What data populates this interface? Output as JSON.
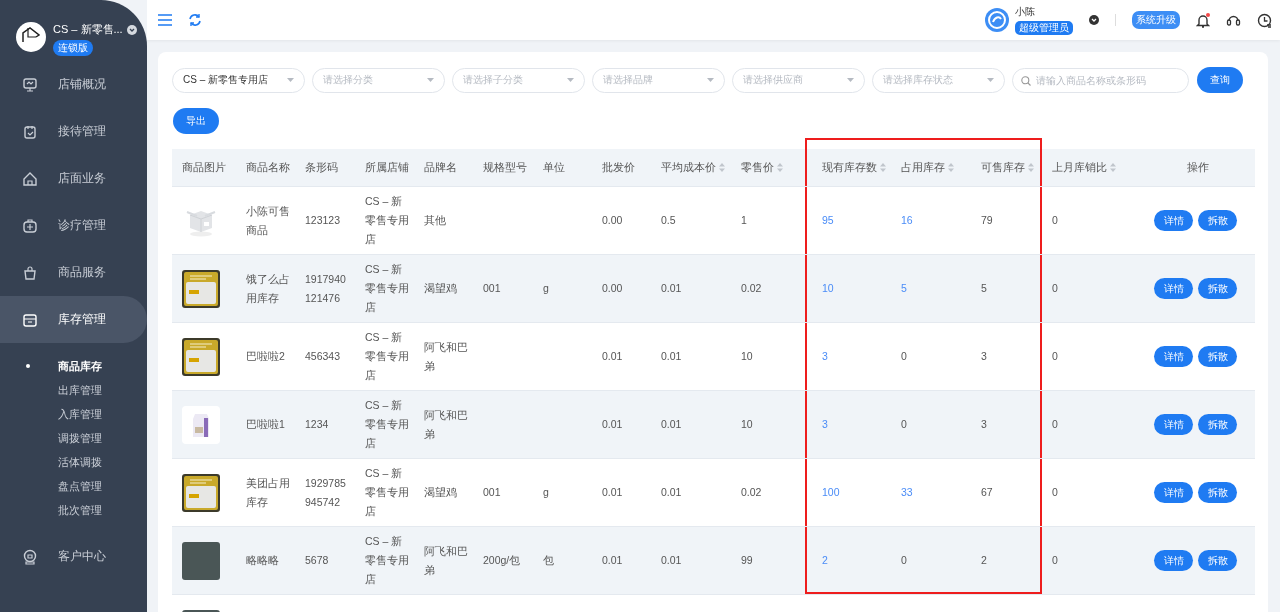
{
  "sidebar": {
    "store_name": "CS – 新零售...",
    "edition_badge": "连锁版",
    "menu": [
      {
        "label": "店铺概况",
        "selected": false,
        "expanded": false
      },
      {
        "label": "接待管理",
        "selected": false,
        "expanded": false
      },
      {
        "label": "店面业务",
        "selected": false,
        "expanded": false
      },
      {
        "label": "诊疗管理",
        "selected": false,
        "expanded": false
      },
      {
        "label": "商品服务",
        "selected": false,
        "expanded": false
      },
      {
        "label": "库存管理",
        "selected": true,
        "expanded": true,
        "children": [
          {
            "label": "商品库存",
            "selected": true
          },
          {
            "label": "出库管理",
            "selected": false
          },
          {
            "label": "入库管理",
            "selected": false
          },
          {
            "label": "调拨管理",
            "selected": false
          },
          {
            "label": "活体调拨",
            "selected": false
          },
          {
            "label": "盘点管理",
            "selected": false
          },
          {
            "label": "批次管理",
            "selected": false
          }
        ]
      },
      {
        "label": "客户中心",
        "selected": false,
        "expanded": false
      }
    ]
  },
  "topbar": {
    "user_name": "小陈",
    "role_badge": "超级管理员",
    "upgrade_button": "系统升级",
    "unread_notifications": true
  },
  "filters": {
    "dropdowns": [
      {
        "value": "CS – 新零售专用店"
      },
      {
        "placeholder": "请选择分类"
      },
      {
        "placeholder": "请选择子分类"
      },
      {
        "placeholder": "请选择品牌"
      },
      {
        "placeholder": "请选择供应商"
      },
      {
        "placeholder": "请选择库存状态"
      }
    ],
    "search": {
      "placeholder": "请输入商品名称或条形码"
    },
    "query_button": "查询",
    "export_button": "导出"
  },
  "table": {
    "columns": [
      {
        "label": "商品图片",
        "sortable": false,
        "highlighted": false
      },
      {
        "label": "商品名称",
        "sortable": false,
        "highlighted": false
      },
      {
        "label": "条形码",
        "sortable": false,
        "highlighted": false
      },
      {
        "label": "所属店铺",
        "sortable": false,
        "highlighted": false
      },
      {
        "label": "品牌名",
        "sortable": false,
        "highlighted": false
      },
      {
        "label": "规格型号",
        "sortable": false,
        "highlighted": false
      },
      {
        "label": "单位",
        "sortable": false,
        "highlighted": false
      },
      {
        "label": "批发价",
        "sortable": false,
        "highlighted": false
      },
      {
        "label": "平均成本价",
        "sortable": true,
        "highlighted": false
      },
      {
        "label": "零售价",
        "sortable": true,
        "highlighted": false
      },
      {
        "label": "现有库存数",
        "sortable": true,
        "highlighted": true
      },
      {
        "label": "占用库存",
        "sortable": true,
        "highlighted": true
      },
      {
        "label": "可售库存",
        "sortable": true,
        "highlighted": true
      },
      {
        "label": "上月库销比",
        "sortable": true,
        "highlighted": false
      },
      {
        "label": "操作",
        "sortable": false,
        "highlighted": false
      }
    ],
    "rows": [
      {
        "image": {
          "kind": "box"
        },
        "cells": [
          {
            "text": "小陈可售商品"
          },
          {
            "text": "123123"
          },
          {
            "text": "CS – 新零售专用店"
          },
          {
            "text": "其他"
          },
          {},
          {},
          {
            "text": "0.00"
          },
          {
            "text": "0.5"
          },
          {
            "text": "1"
          },
          {
            "text": "95",
            "link": true
          },
          {
            "text": "16",
            "link": true
          },
          {
            "text": "79"
          },
          {
            "text": "0"
          }
        ],
        "actions": [
          "详情",
          "拆散"
        ]
      },
      {
        "image": {
          "kind": "bag"
        },
        "cells": [
          {
            "text": "饿了么占用库存"
          },
          {
            "text": "1917940121476"
          },
          {
            "text": "CS – 新零售专用店"
          },
          {
            "text": "渴望鸡"
          },
          {
            "text": "001"
          },
          {
            "text": "g"
          },
          {
            "text": "0.00"
          },
          {
            "text": "0.01"
          },
          {
            "text": "0.02"
          },
          {
            "text": "10",
            "link": true
          },
          {
            "text": "5",
            "link": true
          },
          {
            "text": "5"
          },
          {
            "text": "0"
          }
        ],
        "actions": [
          "详情",
          "拆散"
        ]
      },
      {
        "image": {
          "kind": "bag"
        },
        "cells": [
          {
            "text": "巴啦啦2"
          },
          {
            "text": "456343"
          },
          {
            "text": "CS – 新零售专用店"
          },
          {
            "text": "阿飞和巴弟"
          },
          {},
          {},
          {
            "text": "0.01"
          },
          {
            "text": "0.01"
          },
          {
            "text": "10"
          },
          {
            "text": "3",
            "link": true
          },
          {
            "text": "0"
          },
          {
            "text": "3"
          },
          {
            "text": "0"
          }
        ],
        "actions": [
          "详情",
          "拆散"
        ]
      },
      {
        "image": {
          "kind": "pouch"
        },
        "cells": [
          {
            "text": "巴啦啦1"
          },
          {
            "text": "1234"
          },
          {
            "text": "CS – 新零售专用店"
          },
          {
            "text": "阿飞和巴弟"
          },
          {},
          {},
          {
            "text": "0.01"
          },
          {
            "text": "0.01"
          },
          {
            "text": "10"
          },
          {
            "text": "3",
            "link": true
          },
          {
            "text": "0"
          },
          {
            "text": "3"
          },
          {
            "text": "0"
          }
        ],
        "actions": [
          "详情",
          "拆散"
        ]
      },
      {
        "image": {
          "kind": "bag"
        },
        "cells": [
          {
            "text": "美团占用库存"
          },
          {
            "text": "1929785945742"
          },
          {
            "text": "CS – 新零售专用店"
          },
          {
            "text": "渴望鸡"
          },
          {
            "text": "001"
          },
          {
            "text": "g"
          },
          {
            "text": "0.01"
          },
          {
            "text": "0.01"
          },
          {
            "text": "0.02"
          },
          {
            "text": "100",
            "link": true
          },
          {
            "text": "33",
            "link": true
          },
          {
            "text": "67"
          },
          {
            "text": "0"
          }
        ],
        "actions": [
          "详情",
          "拆散"
        ]
      },
      {
        "image": {
          "kind": "photo"
        },
        "cells": [
          {
            "text": "略略略"
          },
          {
            "text": "5678"
          },
          {
            "text": "CS – 新零售专用店"
          },
          {
            "text": "阿飞和巴弟"
          },
          {
            "text": "200g/包"
          },
          {
            "text": "包"
          },
          {
            "text": "0.01"
          },
          {
            "text": "0.01"
          },
          {
            "text": "99"
          },
          {
            "text": "2",
            "link": true
          },
          {
            "text": "0"
          },
          {
            "text": "2"
          },
          {
            "text": "0"
          }
        ],
        "actions": [
          "详情",
          "拆散"
        ]
      },
      {
        "image": {
          "kind": "photo"
        }
      }
    ]
  }
}
